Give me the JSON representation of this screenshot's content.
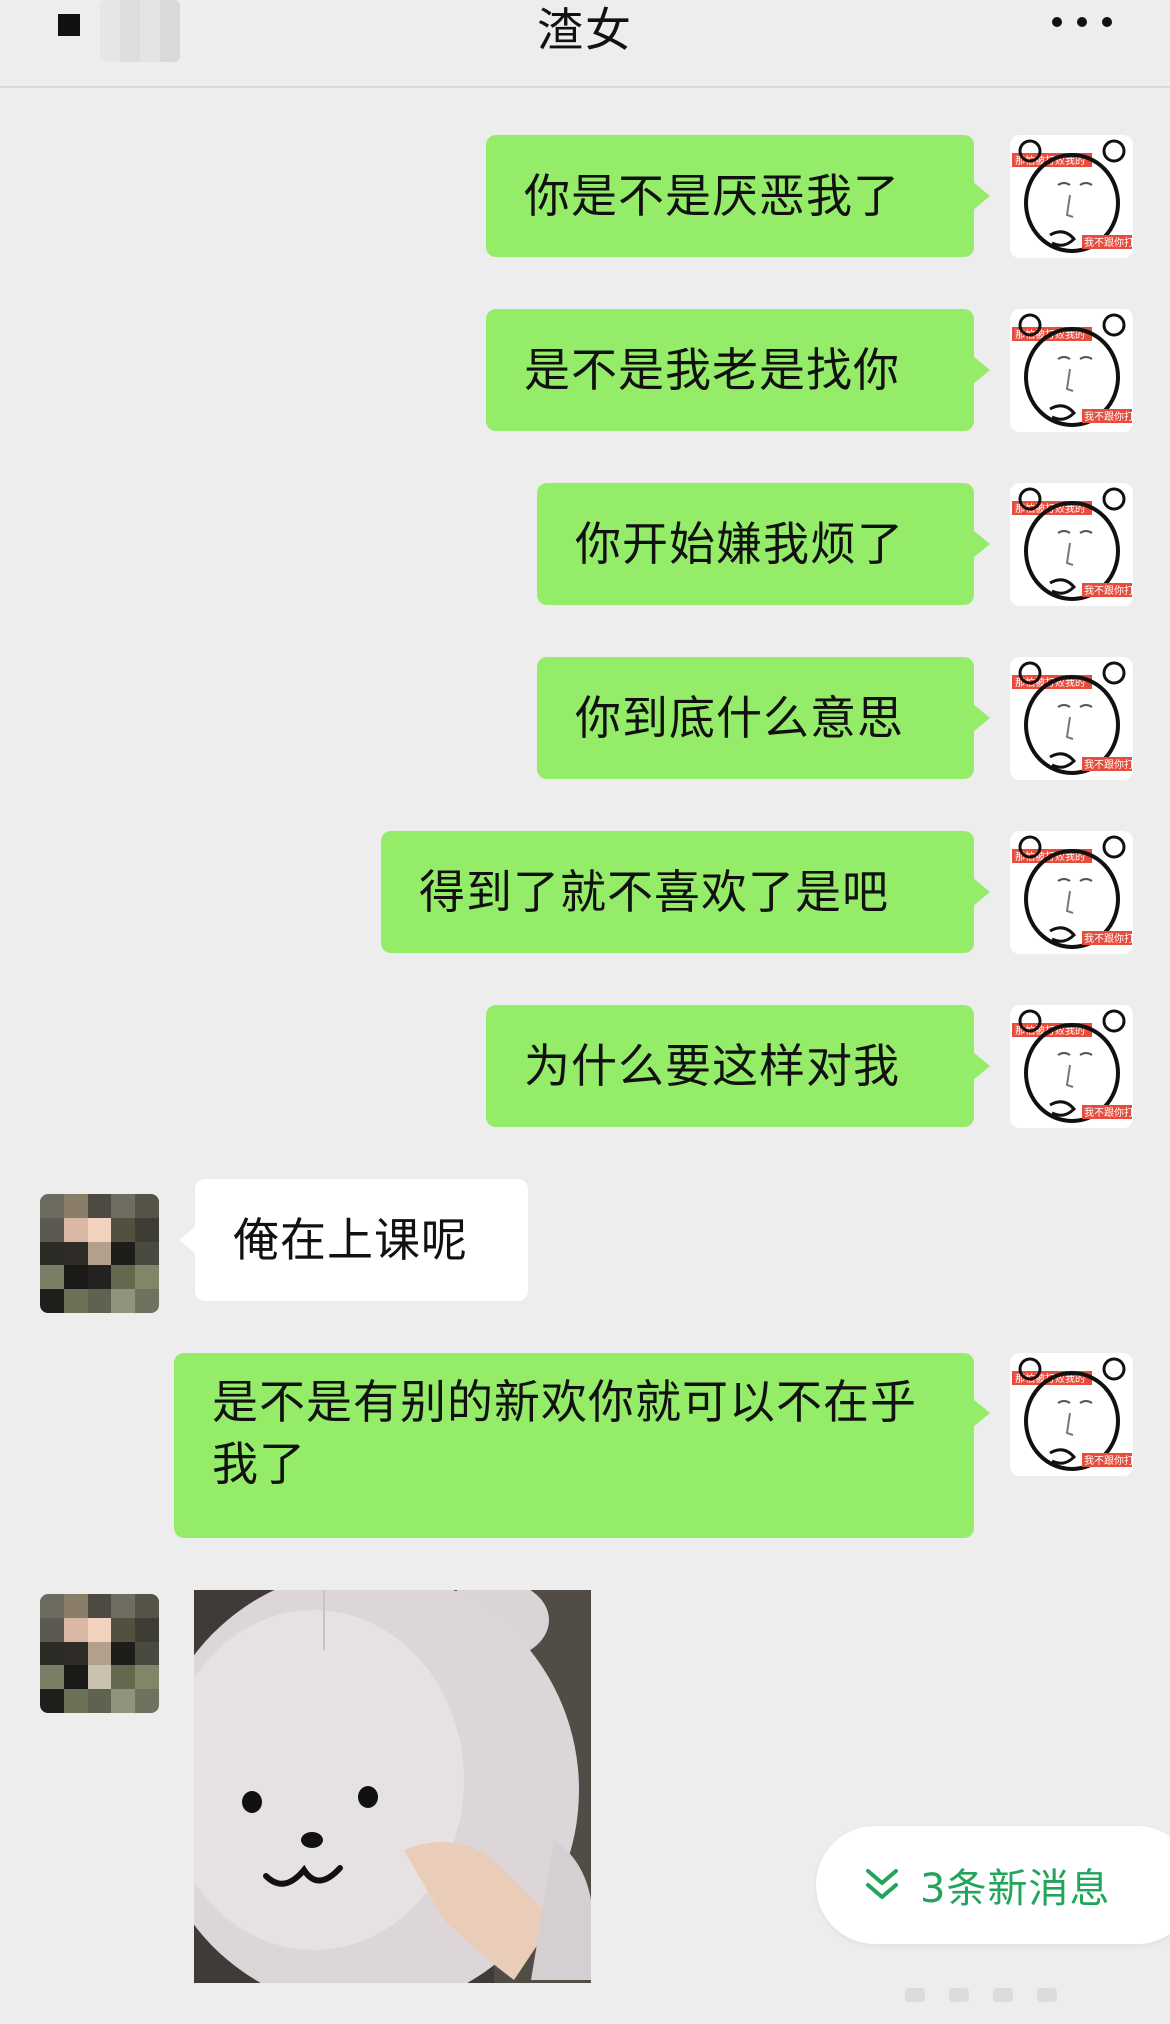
{
  "header": {
    "title": "渣女",
    "back_icon": "back-arrow-icon",
    "more_icon": "more-dots-icon"
  },
  "colors": {
    "background": "#ededed",
    "my_bubble": "#95ec69",
    "their_bubble": "#ffffff",
    "accent_green": "#22a45a"
  },
  "sticker_avatar": {
    "top_caption": "那怕被打败我的",
    "bottom_caption": "我不跟你打"
  },
  "messages": [
    {
      "sender": "me",
      "text": "你是不是厌恶我了"
    },
    {
      "sender": "me",
      "text": "是不是我老是找你"
    },
    {
      "sender": "me",
      "text": "你开始嫌我烦了"
    },
    {
      "sender": "me",
      "text": "你到底什么意思"
    },
    {
      "sender": "me",
      "text": "得到了就不喜欢了是吧"
    },
    {
      "sender": "me",
      "text": "为什么要这样对我"
    },
    {
      "sender": "them",
      "text": "俺在上课呢"
    },
    {
      "sender": "me",
      "text": "是不是有别的新欢你就可以不在乎我了"
    },
    {
      "sender": "them",
      "type": "image",
      "description_icon": "bear-plush-photo"
    }
  ],
  "new_messages_button": {
    "icon": "double-chevron-down-icon",
    "label": "3条新消息"
  }
}
